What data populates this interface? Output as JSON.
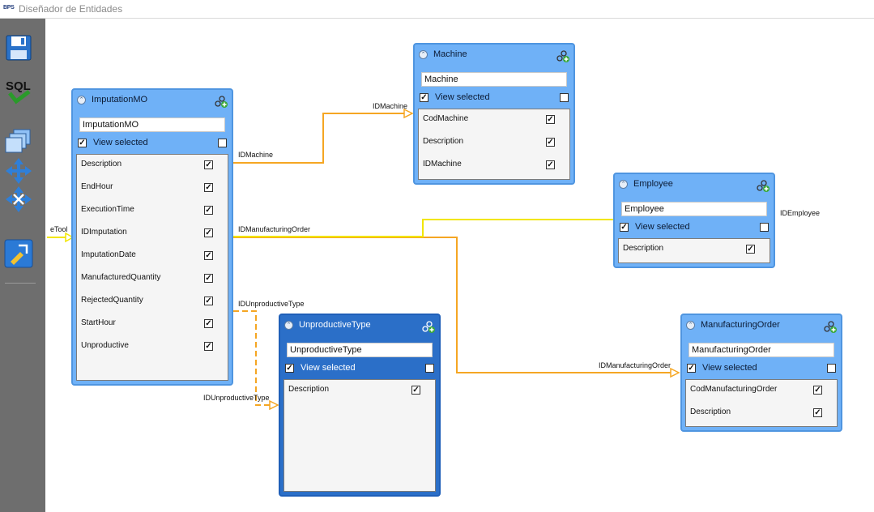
{
  "window": {
    "logo": "BPS",
    "title": "Diseñador de Entidades"
  },
  "toolbar": {
    "sql_label": "SQL"
  },
  "view_selected_label": "View selected",
  "entities": {
    "imputation": {
      "name": "ImputationMO",
      "input": "ImputationMO",
      "fields": [
        "Description",
        "EndHour",
        "ExecutionTime",
        "IDImputation",
        "ImputationDate",
        "ManufacturedQuantity",
        "RejectedQuantity",
        "StartHour",
        "Unproductive"
      ]
    },
    "machine": {
      "name": "Machine",
      "input": "Machine",
      "fields": [
        "CodMachine",
        "Description",
        "IDMachine"
      ]
    },
    "employee": {
      "name": "Employee",
      "input": "Employee",
      "fields": [
        "Description"
      ]
    },
    "unproductive": {
      "name": "UnproductiveType",
      "input": "UnproductiveType",
      "fields": [
        "Description"
      ]
    },
    "manufacturing": {
      "name": "ManufacturingOrder",
      "input": "ManufacturingOrder",
      "fields": [
        "CodManufacturingOrder",
        "Description"
      ]
    }
  },
  "connectors": {
    "machine_src": "IDMachine",
    "machine_dst": "IDMachine",
    "order_src": "IDManufacturingOrder",
    "order_dst": "IDManufacturingOrder",
    "employee_dst": "IDEmployee",
    "unprod_src": "IDUnproductiveType",
    "unprod_dst": "IDUnproductiveType",
    "tool_partial": "eTool"
  },
  "colors": {
    "connector_orange": "#f5a623",
    "connector_yellow": "#f2e600",
    "entity_fill": "#6fb1f7",
    "entity_selected": "#2b6fc8"
  }
}
